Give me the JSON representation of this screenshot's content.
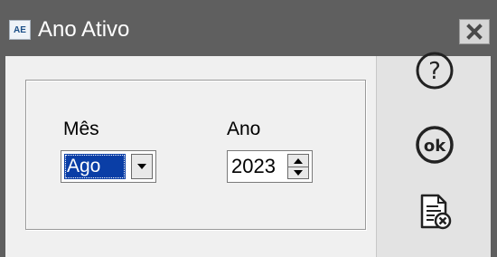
{
  "window": {
    "title": "Ano Ativo",
    "app_icon_text": "AE",
    "icons": {
      "app": "app-icon",
      "close": "close-icon"
    }
  },
  "form": {
    "month_label": "Mês",
    "month_value": "Ago",
    "year_label": "Ano",
    "year_value": "2023"
  },
  "sidebar": {
    "help_icon_text": "?",
    "ok_icon_text": "ok",
    "icons": [
      "help-icon",
      "ok-icon",
      "cancel-document-icon"
    ]
  },
  "colors": {
    "titlebar": "#5f5f5f",
    "selection": "#0a3ea6",
    "background": "#f0f0f0",
    "sidebar": "#e3e3e3"
  }
}
